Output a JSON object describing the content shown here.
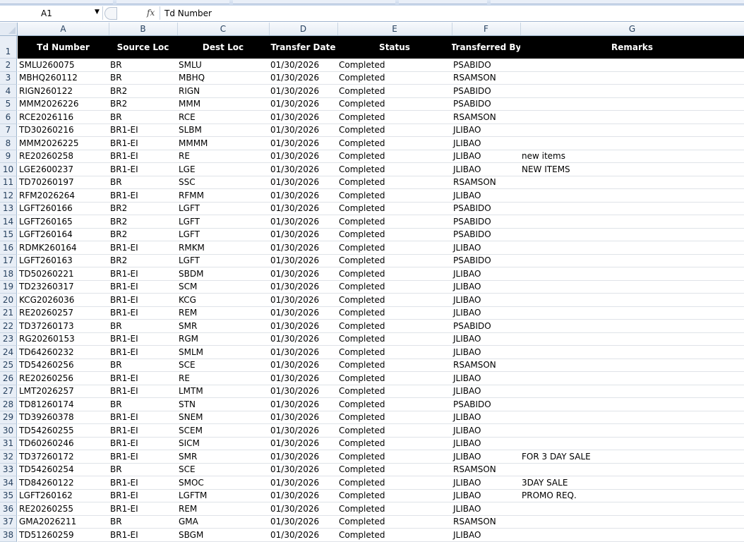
{
  "formula_bar": {
    "name_box": "A1",
    "fx_label": "fx",
    "content": "Td Number"
  },
  "columns": [
    "A",
    "B",
    "C",
    "D",
    "E",
    "F",
    "G"
  ],
  "headers": [
    "Td Number",
    "Source Loc",
    "Dest Loc",
    "Transfer Date",
    "Status",
    "Transferred By",
    "Remarks"
  ],
  "header_row_number": "1",
  "rows": [
    {
      "n": "2",
      "c": [
        "SMLU260075",
        "BR",
        "SMLU",
        "01/30/2026",
        "Completed",
        "PSABIDO",
        ""
      ]
    },
    {
      "n": "3",
      "c": [
        "MBHQ260112",
        "BR",
        "MBHQ",
        "01/30/2026",
        "Completed",
        "RSAMSON",
        ""
      ]
    },
    {
      "n": "4",
      "c": [
        "RIGN260122",
        "BR2",
        "RIGN",
        "01/30/2026",
        "Completed",
        "PSABIDO",
        ""
      ]
    },
    {
      "n": "5",
      "c": [
        "MMM2026226",
        "BR2",
        "MMM",
        "01/30/2026",
        "Completed",
        "PSABIDO",
        ""
      ]
    },
    {
      "n": "6",
      "c": [
        "RCE2026116",
        "BR",
        "RCE",
        "01/30/2026",
        "Completed",
        "RSAMSON",
        ""
      ]
    },
    {
      "n": "7",
      "c": [
        "TD30260216",
        "BR1-EI",
        "SLBM",
        "01/30/2026",
        "Completed",
        "JLIBAO",
        ""
      ]
    },
    {
      "n": "8",
      "c": [
        "MMM2026225",
        "BR1-EI",
        "MMMM",
        "01/30/2026",
        "Completed",
        "JLIBAO",
        ""
      ]
    },
    {
      "n": "9",
      "c": [
        "RE20260258",
        "BR1-EI",
        "RE",
        "01/30/2026",
        "Completed",
        "JLIBAO",
        "new items"
      ]
    },
    {
      "n": "10",
      "c": [
        "LGE2600237",
        "BR1-EI",
        "LGE",
        "01/30/2026",
        "Completed",
        "JLIBAO",
        "NEW ITEMS"
      ]
    },
    {
      "n": "11",
      "c": [
        "TD70260197",
        "BR",
        "SSC",
        "01/30/2026",
        "Completed",
        "RSAMSON",
        ""
      ]
    },
    {
      "n": "12",
      "c": [
        "RFM2026264",
        "BR1-EI",
        "RFMM",
        "01/30/2026",
        "Completed",
        "JLIBAO",
        ""
      ]
    },
    {
      "n": "13",
      "c": [
        "LGFT260166",
        "BR2",
        "LGFT",
        "01/30/2026",
        "Completed",
        "PSABIDO",
        ""
      ]
    },
    {
      "n": "14",
      "c": [
        "LGFT260165",
        "BR2",
        "LGFT",
        "01/30/2026",
        "Completed",
        "PSABIDO",
        ""
      ]
    },
    {
      "n": "15",
      "c": [
        "LGFT260164",
        "BR2",
        "LGFT",
        "01/30/2026",
        "Completed",
        "PSABIDO",
        ""
      ]
    },
    {
      "n": "16",
      "c": [
        "RDMK260164",
        "BR1-EI",
        "RMKM",
        "01/30/2026",
        "Completed",
        "JLIBAO",
        ""
      ]
    },
    {
      "n": "17",
      "c": [
        "LGFT260163",
        "BR2",
        "LGFT",
        "01/30/2026",
        "Completed",
        "PSABIDO",
        ""
      ]
    },
    {
      "n": "18",
      "c": [
        "TD50260221",
        "BR1-EI",
        "SBDM",
        "01/30/2026",
        "Completed",
        "JLIBAO",
        ""
      ]
    },
    {
      "n": "19",
      "c": [
        "TD23260317",
        "BR1-EI",
        "SCM",
        "01/30/2026",
        "Completed",
        "JLIBAO",
        ""
      ]
    },
    {
      "n": "20",
      "c": [
        "KCG2026036",
        "BR1-EI",
        "KCG",
        "01/30/2026",
        "Completed",
        "JLIBAO",
        ""
      ]
    },
    {
      "n": "21",
      "c": [
        "RE20260257",
        "BR1-EI",
        "REM",
        "01/30/2026",
        "Completed",
        "JLIBAO",
        ""
      ]
    },
    {
      "n": "22",
      "c": [
        "TD37260173",
        "BR",
        "SMR",
        "01/30/2026",
        "Completed",
        "PSABIDO",
        ""
      ]
    },
    {
      "n": "23",
      "c": [
        "RG20260153",
        "BR1-EI",
        "RGM",
        "01/30/2026",
        "Completed",
        "JLIBAO",
        ""
      ]
    },
    {
      "n": "24",
      "c": [
        "TD64260232",
        "BR1-EI",
        "SMLM",
        "01/30/2026",
        "Completed",
        "JLIBAO",
        ""
      ]
    },
    {
      "n": "25",
      "c": [
        "TD54260256",
        "BR",
        "SCE",
        "01/30/2026",
        "Completed",
        "RSAMSON",
        ""
      ]
    },
    {
      "n": "26",
      "c": [
        "RE20260256",
        "BR1-EI",
        "RE",
        "01/30/2026",
        "Completed",
        "JLIBAO",
        ""
      ]
    },
    {
      "n": "27",
      "c": [
        "LMT2026257",
        "BR1-EI",
        "LMTM",
        "01/30/2026",
        "Completed",
        "JLIBAO",
        ""
      ]
    },
    {
      "n": "28",
      "c": [
        "TD81260174",
        "BR",
        "STN",
        "01/30/2026",
        "Completed",
        "PSABIDO",
        ""
      ]
    },
    {
      "n": "29",
      "c": [
        "TD39260378",
        "BR1-EI",
        "SNEM",
        "01/30/2026",
        "Completed",
        "JLIBAO",
        ""
      ]
    },
    {
      "n": "30",
      "c": [
        "TD54260255",
        "BR1-EI",
        "SCEM",
        "01/30/2026",
        "Completed",
        "JLIBAO",
        ""
      ]
    },
    {
      "n": "31",
      "c": [
        "TD60260246",
        "BR1-EI",
        "SICM",
        "01/30/2026",
        "Completed",
        "JLIBAO",
        ""
      ]
    },
    {
      "n": "32",
      "c": [
        "TD37260172",
        "BR1-EI",
        "SMR",
        "01/30/2026",
        "Completed",
        "JLIBAO",
        "FOR 3 DAY SALE"
      ]
    },
    {
      "n": "33",
      "c": [
        "TD54260254",
        "BR",
        "SCE",
        "01/30/2026",
        "Completed",
        "RSAMSON",
        ""
      ]
    },
    {
      "n": "34",
      "c": [
        "TD84260122",
        "BR1-EI",
        "SMOC",
        "01/30/2026",
        "Completed",
        "JLIBAO",
        "3DAY SALE"
      ]
    },
    {
      "n": "35",
      "c": [
        "LGFT260162",
        "BR1-EI",
        "LGFTM",
        "01/30/2026",
        "Completed",
        "JLIBAO",
        "PROMO REQ."
      ]
    },
    {
      "n": "36",
      "c": [
        "RE20260255",
        "BR1-EI",
        "REM",
        "01/30/2026",
        "Completed",
        "JLIBAO",
        ""
      ]
    },
    {
      "n": "37",
      "c": [
        "GMA2026211",
        "BR",
        "GMA",
        "01/30/2026",
        "Completed",
        "RSAMSON",
        ""
      ]
    },
    {
      "n": "38",
      "c": [
        "TD51260259",
        "BR1-EI",
        "SBGM",
        "01/30/2026",
        "Completed",
        "JLIBAO",
        ""
      ]
    }
  ]
}
